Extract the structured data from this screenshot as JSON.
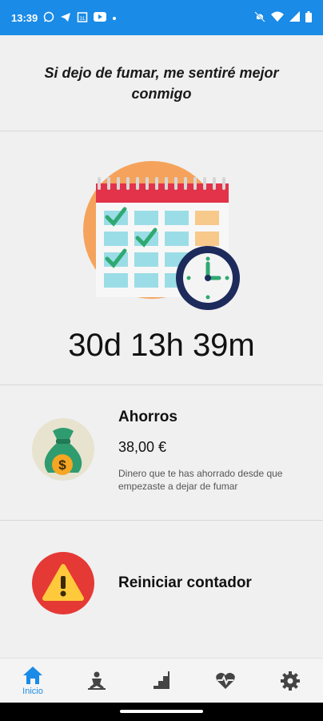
{
  "status_bar": {
    "time": "13:39",
    "left_icons": [
      "whatsapp-icon",
      "telegram-icon",
      "calendar-app-icon",
      "youtube-icon",
      "dot-icon"
    ],
    "right_icons": [
      "mute-icon",
      "wifi-icon",
      "signal-icon",
      "battery-icon"
    ]
  },
  "motivation": {
    "quote": "Si dejo de fumar, me sentiré mejor conmigo"
  },
  "counter": {
    "elapsed": "30d 13h 39m",
    "icon": "calendar-clock-icon"
  },
  "savings": {
    "title": "Ahorros",
    "amount": "38,00 €",
    "description": "Dinero que te has ahorrado desde que empezaste a dejar de fumar",
    "icon": "money-bag-icon"
  },
  "reset": {
    "label": "Reiniciar contador",
    "icon": "warning-icon"
  },
  "bottom_nav": {
    "items": [
      {
        "label": "Inicio",
        "icon": "home-icon",
        "active": true
      },
      {
        "label": "",
        "icon": "meditation-icon",
        "active": false
      },
      {
        "label": "",
        "icon": "stairs-icon",
        "active": false
      },
      {
        "label": "",
        "icon": "heartbeat-icon",
        "active": false
      },
      {
        "label": "",
        "icon": "settings-icon",
        "active": false
      }
    ]
  },
  "colors": {
    "status_bar": "#1a8be6",
    "active_tab": "#1a8be6",
    "inactive_icon": "#444444",
    "warning_red": "#e53935"
  }
}
